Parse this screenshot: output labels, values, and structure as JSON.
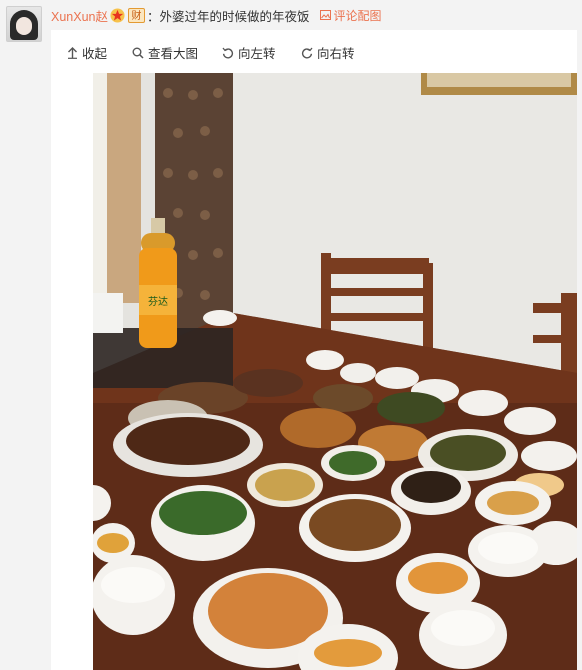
{
  "user": {
    "name": "XunXun赵",
    "vip_badge": "财"
  },
  "post": {
    "text": "：外婆过年的时候做的年夜饭"
  },
  "header": {
    "comment_image_label": "评论配图"
  },
  "toolbar": {
    "collapse_label": "收起",
    "view_large_label": "查看大图",
    "rotate_left_label": "向左转",
    "rotate_right_label": "向右转"
  },
  "photo": {
    "bottle_label": "芬达"
  },
  "icons": [
    "avatar",
    "star-icon",
    "vip-badge",
    "picture-icon",
    "collapse-arrow-icon",
    "search-icon",
    "rotate-left-icon",
    "rotate-right-icon"
  ],
  "colors": {
    "accent": "#eb7350",
    "text": "#333333",
    "background": "#f3f3f3"
  }
}
